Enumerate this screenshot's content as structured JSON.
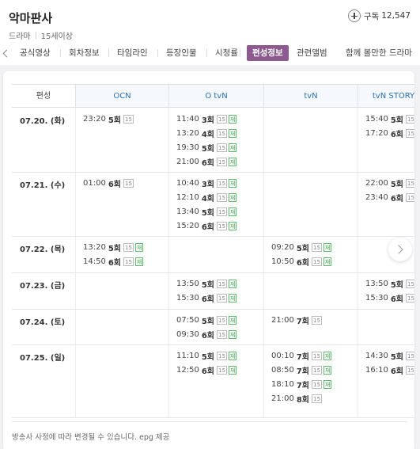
{
  "header": {
    "title": "악마판사",
    "genre": "드라마",
    "rating": "15세이상",
    "subscribe_label": "구독",
    "subscribe_count": "12,547"
  },
  "tabs": [
    "공식영상",
    "회차정보",
    "타임라인",
    "등장인물",
    "시청률",
    "편성정보",
    "관련앨범",
    "함께 볼만한 드라마"
  ],
  "active_tab": "편성정보",
  "schedule": {
    "corner_label": "편성",
    "channels": [
      "OCN",
      "O tvN",
      "tvN",
      "tvN STORY"
    ],
    "rows": [
      {
        "date": "07.20. (화)",
        "cells": [
          [
            {
              "time": "23:20",
              "ep": "5회",
              "badges": [
                "15"
              ]
            }
          ],
          [
            {
              "time": "11:40",
              "ep": "3회",
              "badges": [
                "15",
                "재"
              ]
            },
            {
              "time": "13:20",
              "ep": "4회",
              "badges": [
                "15",
                "재"
              ]
            },
            {
              "time": "19:30",
              "ep": "5회",
              "badges": [
                "15",
                "재"
              ]
            },
            {
              "time": "21:00",
              "ep": "6회",
              "badges": [
                "15",
                "재"
              ]
            }
          ],
          [],
          [
            {
              "time": "15:40",
              "ep": "5회",
              "badges": [
                "15",
                "재"
              ]
            },
            {
              "time": "17:20",
              "ep": "6회",
              "badges": [
                "15",
                "재"
              ]
            }
          ]
        ]
      },
      {
        "date": "07.21. (수)",
        "cells": [
          [
            {
              "time": "01:00",
              "ep": "6회",
              "badges": [
                "15"
              ]
            }
          ],
          [
            {
              "time": "10:40",
              "ep": "3회",
              "badges": [
                "15",
                "재"
              ]
            },
            {
              "time": "12:10",
              "ep": "4회",
              "badges": [
                "15",
                "재"
              ]
            },
            {
              "time": "13:40",
              "ep": "5회",
              "badges": [
                "15",
                "재"
              ]
            },
            {
              "time": "15:20",
              "ep": "6회",
              "badges": [
                "15",
                "재"
              ]
            }
          ],
          [],
          [
            {
              "time": "22:00",
              "ep": "5회",
              "badges": [
                "15",
                "재"
              ]
            },
            {
              "time": "23:40",
              "ep": "6회",
              "badges": [
                "15",
                "재"
              ]
            }
          ]
        ]
      },
      {
        "date": "07.22. (목)",
        "cells": [
          [
            {
              "time": "13:20",
              "ep": "5회",
              "badges": [
                "15",
                "재"
              ]
            },
            {
              "time": "14:50",
              "ep": "6회",
              "badges": [
                "15",
                "재"
              ]
            }
          ],
          [],
          [
            {
              "time": "09:20",
              "ep": "5회",
              "badges": [
                "15",
                "재"
              ]
            },
            {
              "time": "10:50",
              "ep": "6회",
              "badges": [
                "15",
                "재"
              ]
            }
          ],
          []
        ]
      },
      {
        "date": "07.23. (금)",
        "cells": [
          [],
          [
            {
              "time": "13:50",
              "ep": "5회",
              "badges": [
                "15",
                "재"
              ]
            },
            {
              "time": "15:30",
              "ep": "6회",
              "badges": [
                "15",
                "재"
              ]
            }
          ],
          [],
          [
            {
              "time": "13:50",
              "ep": "5회",
              "badges": [
                "15",
                "재"
              ]
            },
            {
              "time": "15:30",
              "ep": "6회",
              "badges": [
                "15",
                "재"
              ]
            }
          ]
        ]
      },
      {
        "date": "07.24. (토)",
        "cells": [
          [],
          [
            {
              "time": "07:50",
              "ep": "5회",
              "badges": [
                "15",
                "재"
              ]
            },
            {
              "time": "09:30",
              "ep": "6회",
              "badges": [
                "15",
                "재"
              ]
            }
          ],
          [
            {
              "time": "21:00",
              "ep": "7회",
              "badges": [
                "15"
              ]
            }
          ],
          []
        ]
      },
      {
        "date": "07.25. (일)",
        "cells": [
          [],
          [
            {
              "time": "11:10",
              "ep": "5회",
              "badges": [
                "15",
                "재"
              ]
            },
            {
              "time": "12:50",
              "ep": "6회",
              "badges": [
                "15",
                "재"
              ]
            }
          ],
          [
            {
              "time": "00:10",
              "ep": "7회",
              "badges": [
                "15",
                "재"
              ]
            },
            {
              "time": "08:50",
              "ep": "7회",
              "badges": [
                "15",
                "재"
              ]
            },
            {
              "time": "18:10",
              "ep": "7회",
              "badges": [
                "15",
                "재"
              ]
            },
            {
              "time": "21:00",
              "ep": "8회",
              "badges": [
                "15"
              ]
            }
          ],
          [
            {
              "time": "14:30",
              "ep": "5회",
              "badges": [
                "15",
                "재"
              ]
            },
            {
              "time": "16:10",
              "ep": "6회",
              "badges": [
                "15",
                "재"
              ]
            }
          ]
        ]
      }
    ]
  },
  "notice": "방송사 사정에 따라 변경될 수 있습니다. epg 제공",
  "colors": {
    "accent": "#8c5a8e",
    "channel_text": "#2b6fb3",
    "rerun_badge": "#3aa64c"
  }
}
